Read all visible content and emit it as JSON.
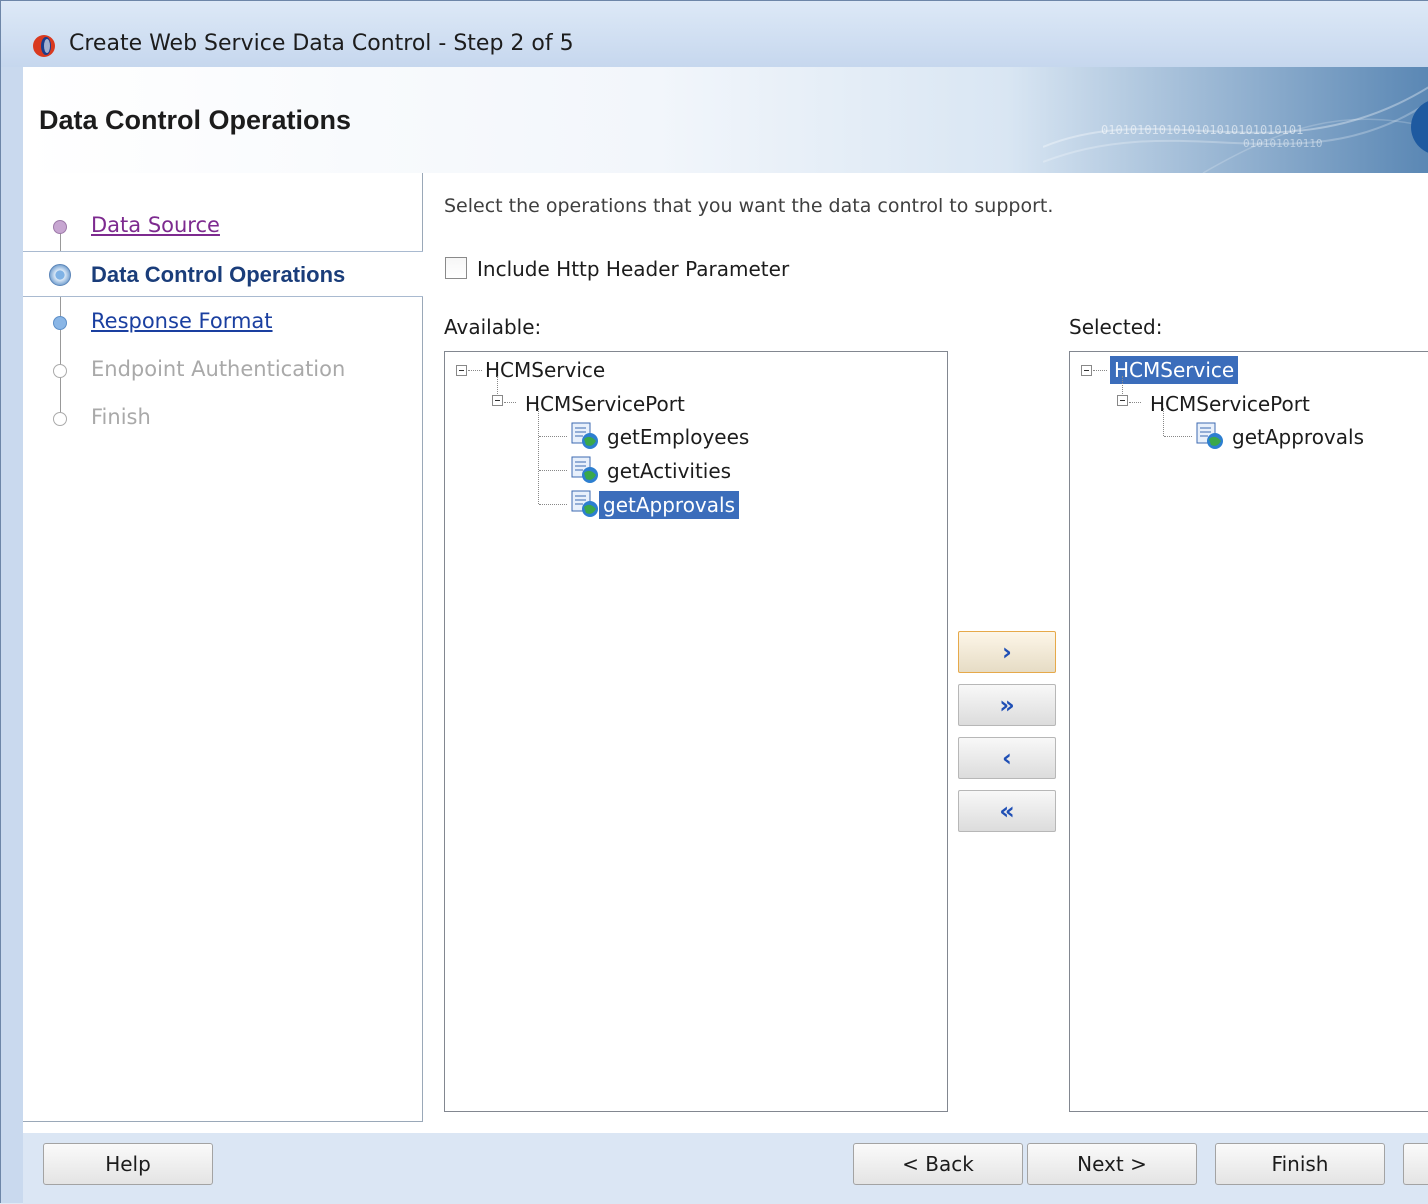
{
  "window": {
    "title": "Create Web Service Data Control - Step 2 of 5",
    "icon": "oracle-jdeveloper-icon"
  },
  "header": {
    "heading": "Data Control Operations",
    "binary_line1": "0101010101010101010101010101",
    "binary_line2": "010101010110"
  },
  "nav": {
    "steps": [
      {
        "label": "Data Source",
        "state": "visited"
      },
      {
        "label": "Data Control Operations",
        "state": "current"
      },
      {
        "label": "Response Format",
        "state": "link"
      },
      {
        "label": "Endpoint Authentication",
        "state": "disabled"
      },
      {
        "label": "Finish",
        "state": "disabled"
      }
    ]
  },
  "main": {
    "instructions": "Select the operations that you want the data control to support.",
    "include_header_label": "Include Http Header Parameter",
    "include_header_checked": false,
    "available_label": "Available:",
    "selected_label": "Selected:",
    "available_tree": {
      "service": "HCMService",
      "port": "HCMServicePort",
      "operations": [
        "getEmployees",
        "getActivities",
        "getApprovals"
      ],
      "selected_operation": "getApprovals"
    },
    "selected_tree": {
      "service": "HCMService",
      "port": "HCMServicePort",
      "operations": [
        "getApprovals"
      ]
    },
    "shuttle": {
      "move": "›",
      "move_all": "»",
      "remove": "‹",
      "remove_all": "«"
    }
  },
  "footer": {
    "help": "Help",
    "back": "< Back",
    "next": "Next >",
    "finish": "Finish"
  },
  "colors": {
    "selection": "#3b6dbb",
    "visited_link": "#7d2a8f",
    "link": "#1a3fa0",
    "shuttle_arrow": "#1f4fb5"
  }
}
